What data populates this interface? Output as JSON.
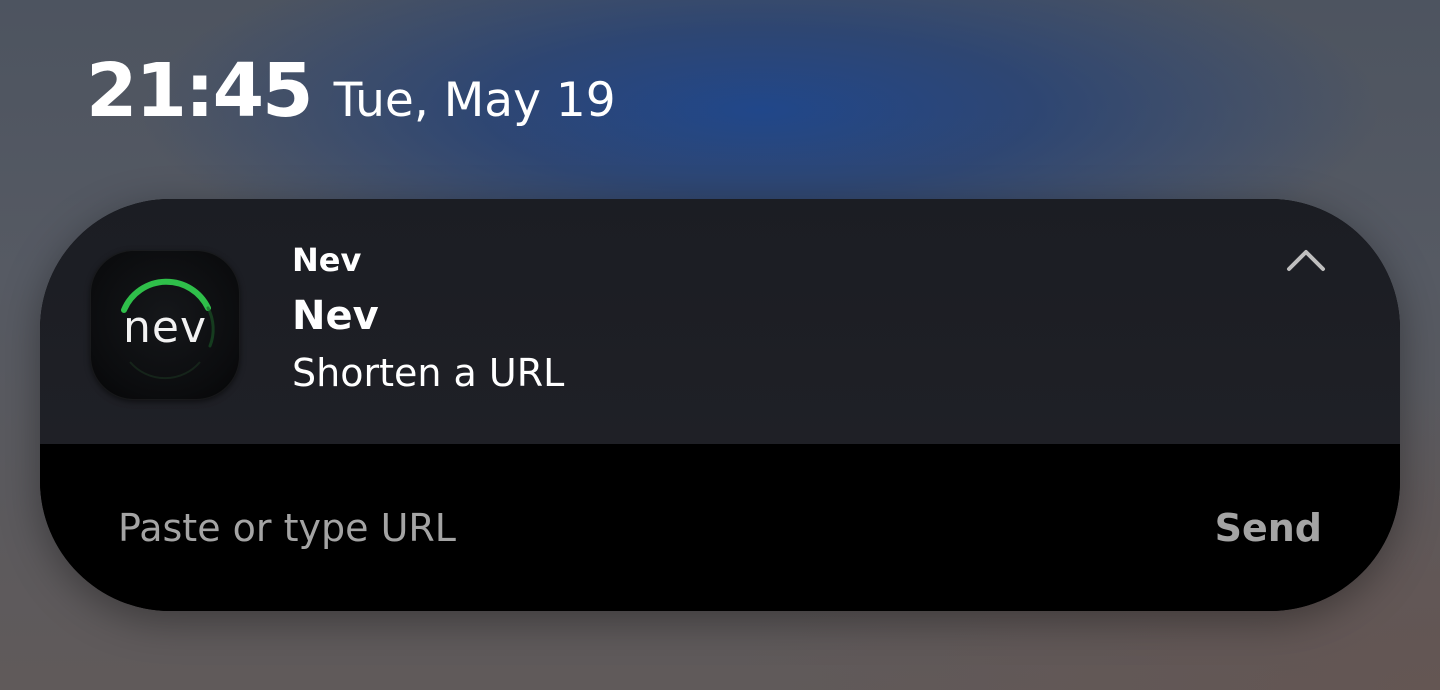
{
  "lockscreen": {
    "time": "21:45",
    "date": "Tue, May 19"
  },
  "notification": {
    "app_name": "Nev",
    "app_icon": {
      "name": "nev-app-icon",
      "label": "nev",
      "accent_color": "#2fbf4a"
    },
    "title": "Nev",
    "body": "Shorten a URL",
    "collapse_icon": "chevron-up-icon"
  },
  "reply": {
    "placeholder": "Paste or type URL",
    "value": "",
    "send_label": "Send"
  }
}
